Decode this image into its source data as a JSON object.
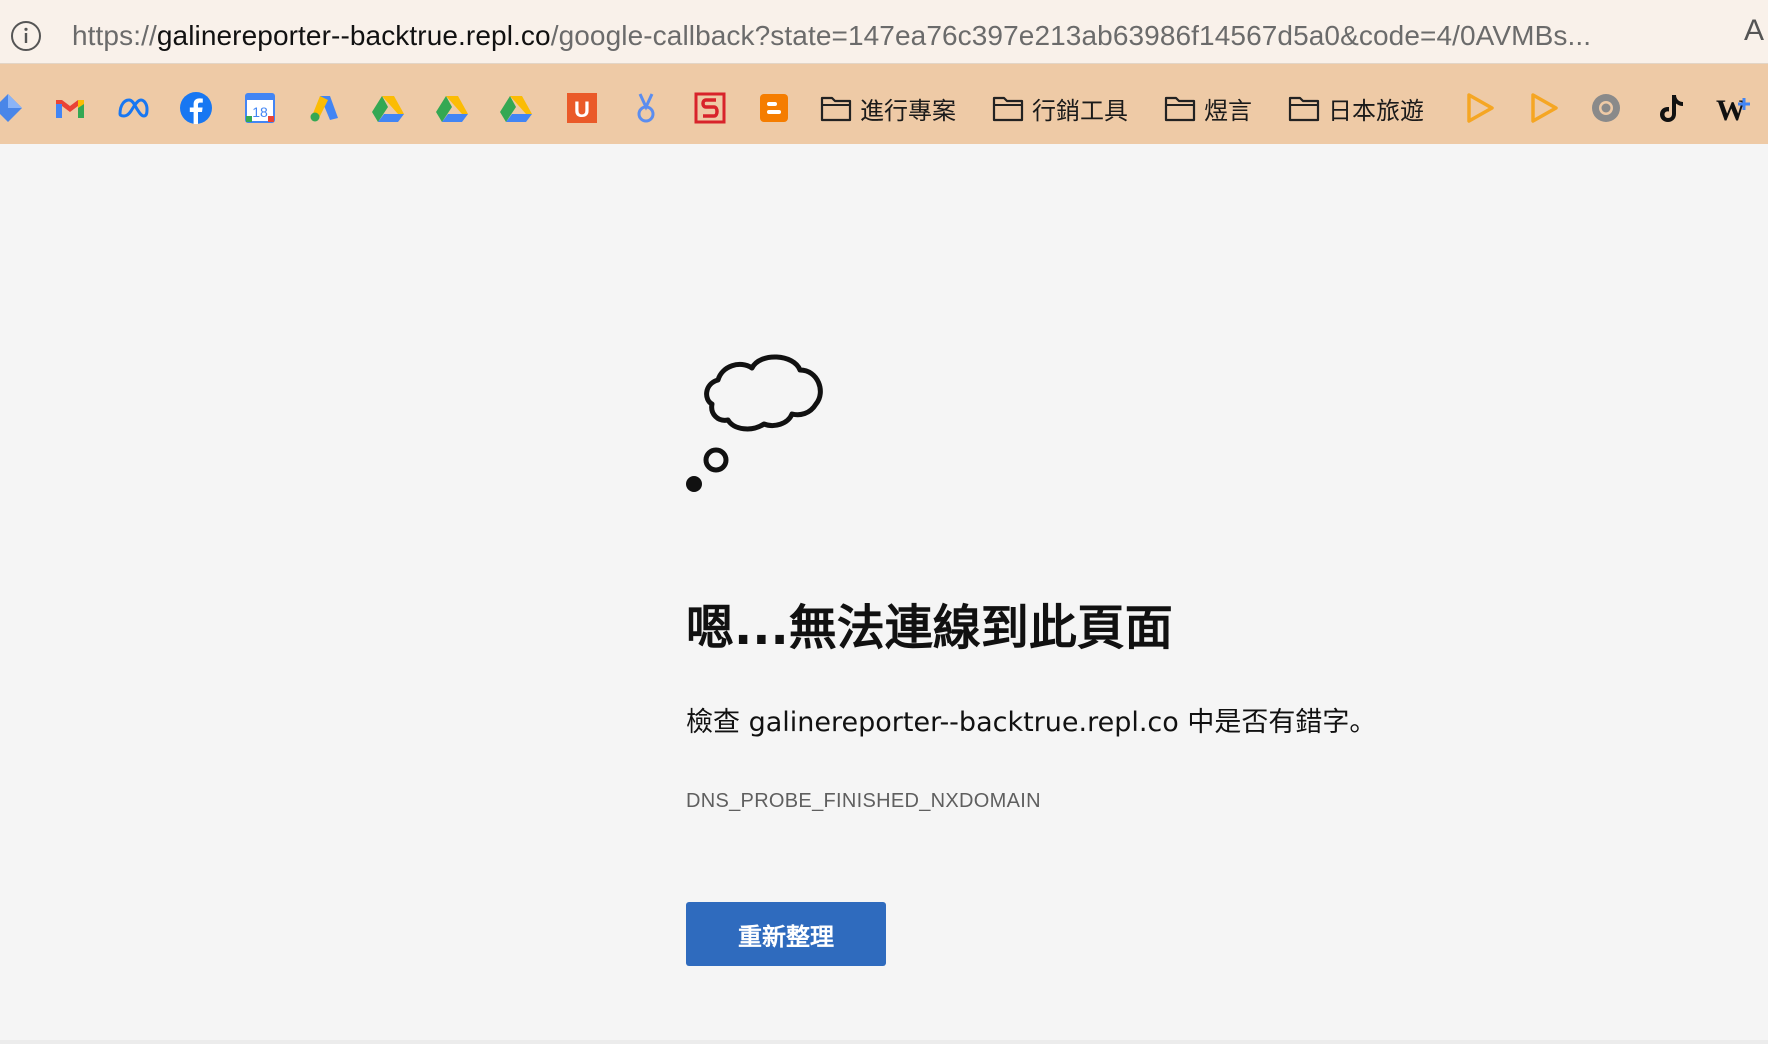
{
  "address_bar": {
    "url_scheme": "https://",
    "url_host": "galinereporter--backtrue.repl.co",
    "url_rest": "/google-callback?state=147ea76c397e213ab63986f14567d5a0&code=4/0AVMBs...",
    "icons": [
      "info-icon",
      "reader-view-icon"
    ],
    "reader_glyph": "A"
  },
  "bookmarks": {
    "favicons": [
      "diamond-icon",
      "gmail-icon",
      "meta-icon",
      "facebook-icon",
      "google-calendar-icon",
      "google-ads-icon",
      "google-drive-icon",
      "google-drive-icon",
      "google-drive-icon",
      "u-icon",
      "ribbon-icon",
      "s-logo-icon",
      "blogger-icon"
    ],
    "calendar_day": "18",
    "u_letter": "U",
    "folders": [
      {
        "label": "進行專案"
      },
      {
        "label": "行銷工具"
      },
      {
        "label": "煜言"
      },
      {
        "label": "日本旅遊"
      }
    ],
    "trailing_icons": [
      "play-icon",
      "play-icon",
      "chromium-icon",
      "tiktok-icon",
      "w-plus-icon"
    ],
    "w_letter": "W",
    "colors": {
      "bar": "#eecaa6",
      "play": "#f5a623"
    }
  },
  "error": {
    "icon": "thought-cloud-icon",
    "title": "嗯...無法連線到此頁面",
    "description": "檢查 galinereporter--backtrue.repl.co 中是否有錯字。",
    "code": "DNS_PROBE_FINISHED_NXDOMAIN",
    "reload_label": "重新整理",
    "colors": {
      "button": "#2f6bbe",
      "background": "#f5f5f5"
    }
  }
}
